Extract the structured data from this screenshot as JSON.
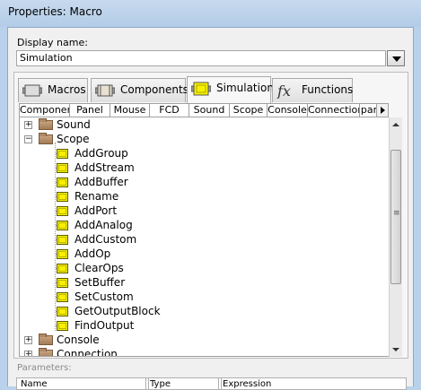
{
  "window": {
    "title": "Properties: Macro"
  },
  "display_name": {
    "label": "Display name:",
    "value": "Simulation"
  },
  "tabs": [
    {
      "label": "Macros",
      "icon": "macros-icon",
      "active": false
    },
    {
      "label": "Components",
      "icon": "components-icon",
      "active": false
    },
    {
      "label": "Simulation",
      "icon": "simulation-icon",
      "active": true
    },
    {
      "label": "Functions",
      "icon": "fx-icon",
      "active": false
    }
  ],
  "columns": [
    "Component",
    "Panel",
    "Mouse",
    "FCD",
    "Sound",
    "Scope",
    "Console",
    "Connection",
    "par"
  ],
  "tree": {
    "sound": "Sound",
    "scope": "Scope",
    "scope_children": [
      "AddGroup",
      "AddStream",
      "AddBuffer",
      "Rename",
      "AddPort",
      "AddAnalog",
      "AddCustom",
      "AddOp",
      "ClearOps",
      "SetBuffer",
      "SetCustom",
      "GetOutputBlock",
      "FindOutput"
    ],
    "console": "Console",
    "connection": "Connection"
  },
  "parameters": {
    "label": "Parameters:",
    "columns": [
      "Name",
      "Type",
      "Expression"
    ]
  },
  "colors": {
    "titlebar": "#c4d8ee",
    "function_icon": "#f7f000",
    "folder": "#b08a64"
  }
}
